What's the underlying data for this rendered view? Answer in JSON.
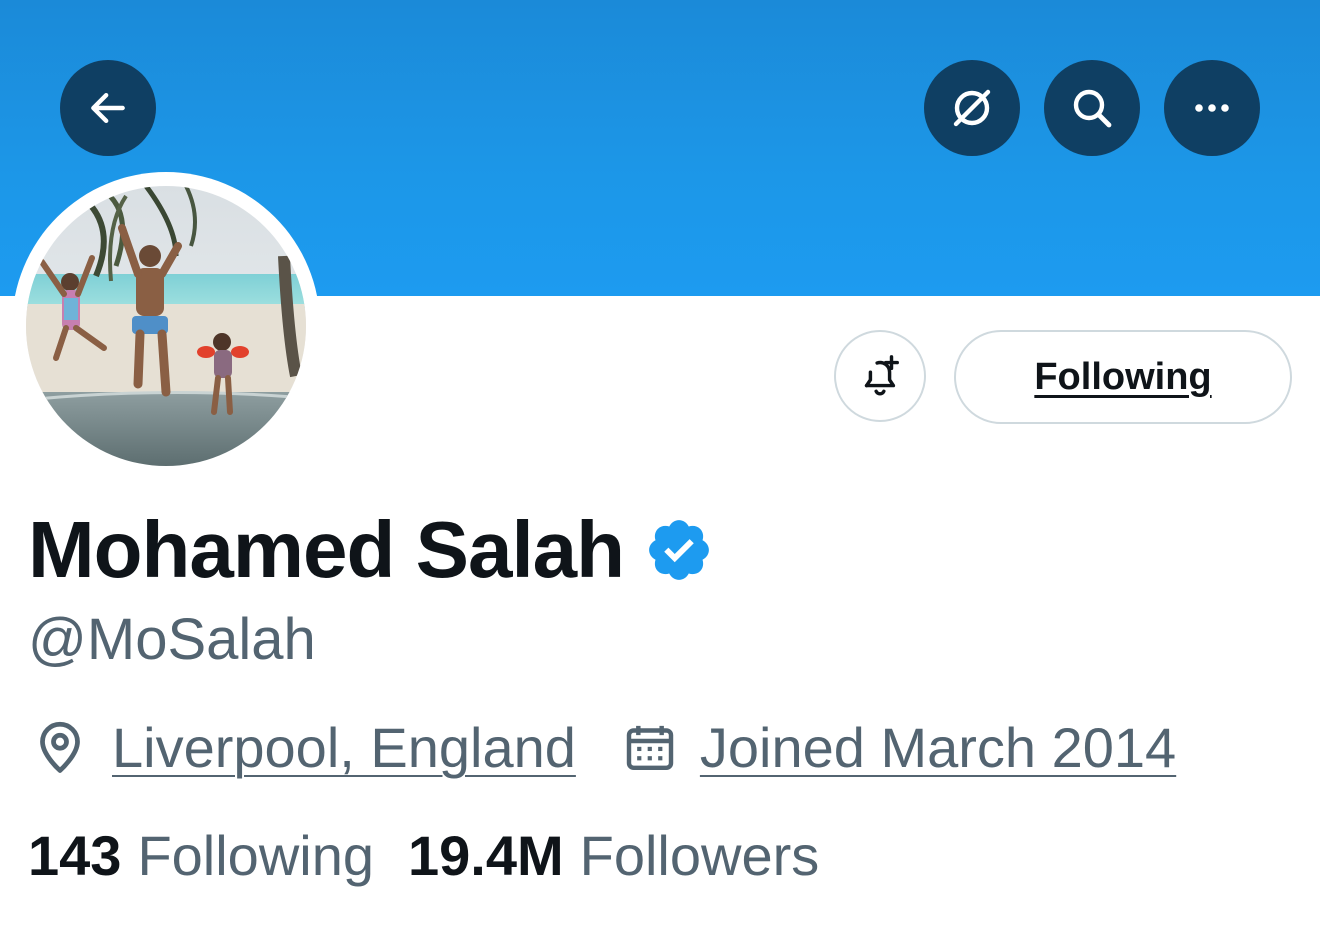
{
  "header": {
    "back_icon": "arrow-left-icon",
    "translate_icon": "translate-slash-icon",
    "search_icon": "search-icon",
    "more_icon": "more-horizontal-icon",
    "banner_color": "#1d9bf0",
    "button_color": "#0f3f63"
  },
  "profile": {
    "display_name": "Mohamed Salah",
    "verified": true,
    "verified_color": "#1d9bf0",
    "handle": "@MoSalah",
    "location": "Liverpool, England",
    "joined": "Joined March 2014",
    "following_count": "143",
    "following_label": "Following",
    "followers_count": "19.4M",
    "followers_label": "Followers"
  },
  "actions": {
    "notify_icon": "bell-plus-icon",
    "following_button_label": "Following"
  }
}
